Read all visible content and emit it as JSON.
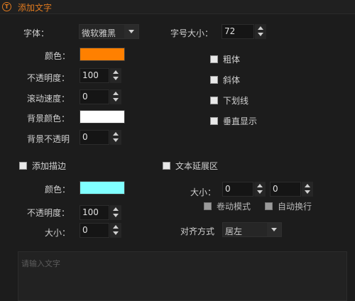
{
  "title": {
    "icon": "text-t-icon",
    "text": "添加文字"
  },
  "font": {
    "label": "字体：",
    "value": "微软雅黑"
  },
  "font_size": {
    "label": "字号大小：",
    "value": "72"
  },
  "color": {
    "label": "颜色：",
    "value": "#ff8000"
  },
  "opacity": {
    "label": "不透明度：",
    "value": "100"
  },
  "scroll_speed": {
    "label": "滚动速度：",
    "value": "0"
  },
  "bg_color": {
    "label": "背景颜色：",
    "value": "#ffffff"
  },
  "bg_opacity": {
    "label": "背景不透明",
    "value": "0"
  },
  "style_options": {
    "bold": "粗体",
    "italic": "斜体",
    "underline": "下划线",
    "vertical": "垂直显示"
  },
  "stroke": {
    "checkbox_label": "添加描边",
    "color_label": "颜色：",
    "color_value": "#80ffff",
    "opacity_label": "不透明度：",
    "opacity_value": "100",
    "size_label": "大小：",
    "size_value": "0"
  },
  "text_area_ext": {
    "checkbox_label": "文本延展区",
    "size_label": "大小：",
    "width_value": "0",
    "height_value": "0",
    "scroll_mode": "卷动模式",
    "auto_wrap": "自动换行",
    "align_label": "对齐方式",
    "align_value": "居左"
  },
  "text_input": {
    "placeholder": "请输入文字"
  }
}
